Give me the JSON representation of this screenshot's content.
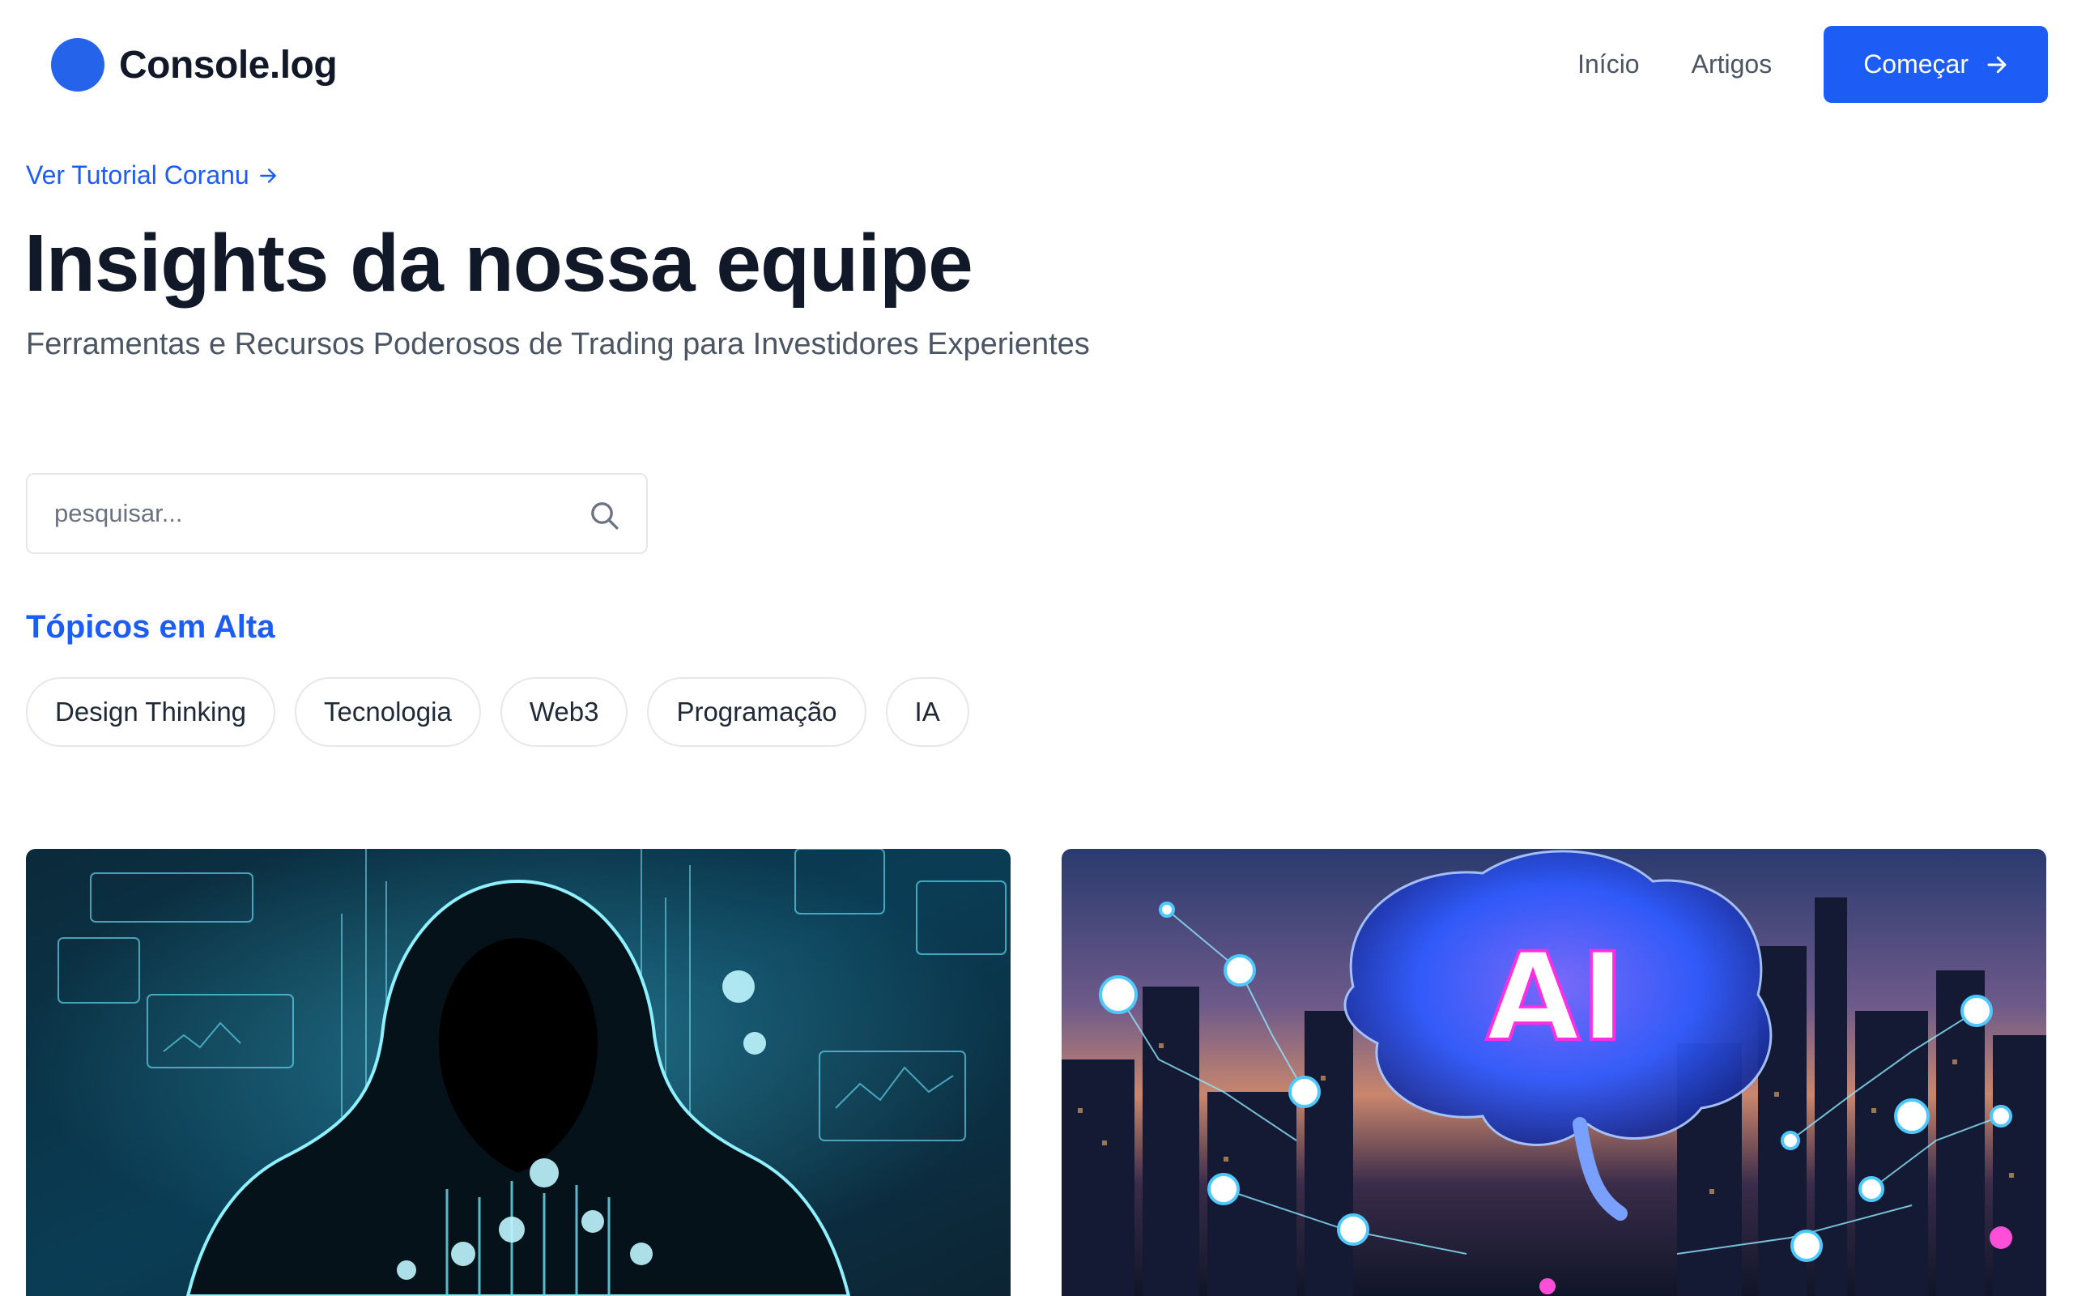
{
  "header": {
    "logo_text": "Console.log",
    "nav": [
      {
        "label": "Início"
      },
      {
        "label": "Artigos"
      }
    ],
    "cta_label": "Começar"
  },
  "hero": {
    "tutorial_link": "Ver Tutorial Coranu",
    "title": "Insights da nossa equipe",
    "subtitle": "Ferramentas e Recursos Poderosos de Trading para Investidores Experientes"
  },
  "search": {
    "placeholder": "pesquisar...",
    "value": ""
  },
  "topics": {
    "title": "Tópicos em Alta",
    "items": [
      {
        "label": "Design Thinking"
      },
      {
        "label": "Tecnologia"
      },
      {
        "label": "Web3"
      },
      {
        "label": "Programação"
      },
      {
        "label": "IA"
      }
    ]
  },
  "cards": [
    {
      "image": "hooded-hacker-cyber-finance-illustration"
    },
    {
      "image": "ai-brain-over-city-network-illustration",
      "image_text": "AI"
    }
  ],
  "colors": {
    "accent": "#1d5cf5",
    "logo": "#2563eb",
    "text": "#111827",
    "muted": "#4b5563",
    "border": "#e5e7eb"
  },
  "icons": [
    "logo-dot-icon",
    "arrow-right-icon",
    "search-icon"
  ]
}
